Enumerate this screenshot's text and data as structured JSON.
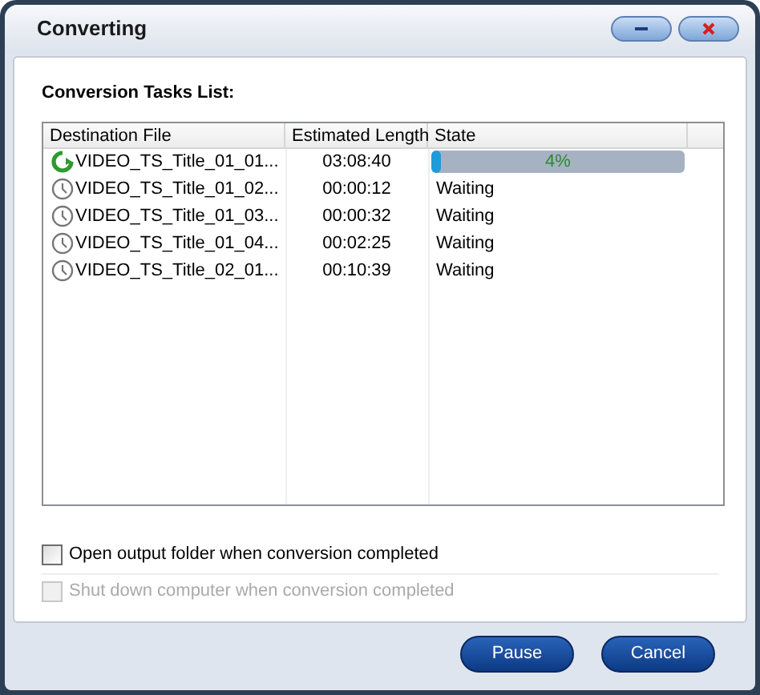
{
  "window": {
    "title": "Converting"
  },
  "list_title": "Conversion Tasks List:",
  "table": {
    "columns": [
      "Destination File",
      "Estimated Length",
      "State"
    ],
    "rows": [
      {
        "kind": "converting",
        "file": "VIDEO_TS_Title_01_01...",
        "length": "03:08:40",
        "state": {
          "kind": "progress",
          "level": 0.04,
          "reading": "4%"
        }
      },
      {
        "kind": "waiting",
        "file": "VIDEO_TS_Title_01_02...",
        "length": "00:00:12",
        "state": {
          "kind": "text",
          "text": "Waiting"
        }
      },
      {
        "kind": "waiting",
        "file": "VIDEO_TS_Title_01_03...",
        "length": "00:00:32",
        "state": {
          "kind": "text",
          "text": "Waiting"
        }
      },
      {
        "kind": "waiting",
        "file": "VIDEO_TS_Title_01_04...",
        "length": "00:02:25",
        "state": {
          "kind": "text",
          "text": "Waiting"
        }
      },
      {
        "kind": "waiting",
        "file": "VIDEO_TS_Title_02_01...",
        "length": "00:10:39",
        "state": {
          "kind": "text",
          "text": "Waiting"
        }
      }
    ]
  },
  "options": [
    {
      "label": "Open output folder when conversion completed",
      "checked": false,
      "disabled": false
    },
    {
      "label": "Shut down computer when conversion completed",
      "checked": false,
      "disabled": true
    }
  ],
  "buttons": [
    "Pause",
    "Cancel"
  ]
}
